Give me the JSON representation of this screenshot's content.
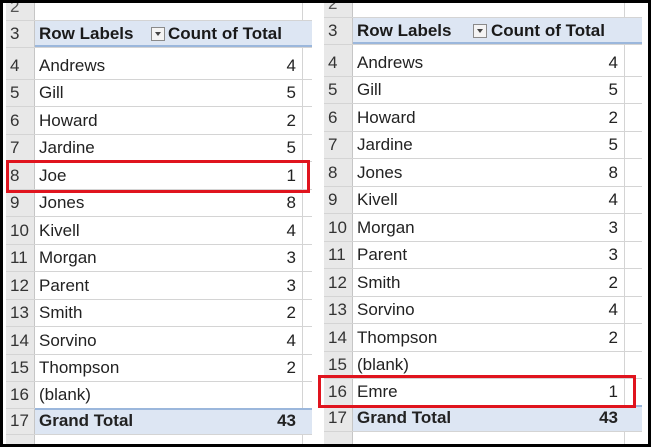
{
  "left_pivot": {
    "header": {
      "row": "3",
      "row_labels": "Row Labels",
      "value_header": "Count of Total"
    },
    "top_row_number": "2",
    "rows": [
      {
        "num": "4",
        "label": "Andrews",
        "value": "4"
      },
      {
        "num": "5",
        "label": "Gill",
        "value": "5"
      },
      {
        "num": "6",
        "label": "Howard",
        "value": "2"
      },
      {
        "num": "7",
        "label": "Jardine",
        "value": "5"
      },
      {
        "num": "8",
        "label": "Joe",
        "value": "1"
      },
      {
        "num": "9",
        "label": "Jones",
        "value": "8"
      },
      {
        "num": "10",
        "label": "Kivell",
        "value": "4"
      },
      {
        "num": "11",
        "label": "Morgan",
        "value": "3"
      },
      {
        "num": "12",
        "label": "Parent",
        "value": "3"
      },
      {
        "num": "13",
        "label": "Smith",
        "value": "2"
      },
      {
        "num": "14",
        "label": "Sorvino",
        "value": "4"
      },
      {
        "num": "15",
        "label": "Thompson",
        "value": "2"
      },
      {
        "num": "16",
        "label": "(blank)",
        "value": ""
      }
    ],
    "total": {
      "num": "17",
      "label": "Grand Total",
      "value": "43"
    },
    "highlighted_label": "Joe"
  },
  "right_pivot": {
    "header": {
      "row": "3",
      "row_labels": "Row Labels",
      "value_header": "Count of Total"
    },
    "top_row_number": "2",
    "rows": [
      {
        "num": "4",
        "label": "Andrews",
        "value": "4"
      },
      {
        "num": "5",
        "label": "Gill",
        "value": "5"
      },
      {
        "num": "6",
        "label": "Howard",
        "value": "2"
      },
      {
        "num": "7",
        "label": "Jardine",
        "value": "5"
      },
      {
        "num": "8",
        "label": "Jones",
        "value": "8"
      },
      {
        "num": "9",
        "label": "Kivell",
        "value": "4"
      },
      {
        "num": "10",
        "label": "Morgan",
        "value": "3"
      },
      {
        "num": "11",
        "label": "Parent",
        "value": "3"
      },
      {
        "num": "12",
        "label": "Smith",
        "value": "2"
      },
      {
        "num": "13",
        "label": "Sorvino",
        "value": "4"
      },
      {
        "num": "14",
        "label": "Thompson",
        "value": "2"
      },
      {
        "num": "15",
        "label": "(blank)",
        "value": ""
      },
      {
        "num": "16",
        "label": "Emre",
        "value": "1"
      }
    ],
    "total": {
      "num": "17",
      "label": "Grand Total",
      "value": "43"
    },
    "highlighted_label": "Emre"
  },
  "colors": {
    "highlight": "#e0141e",
    "pivot_header_fill": "#dde6f3",
    "row_header_fill": "#e8e8e8"
  }
}
